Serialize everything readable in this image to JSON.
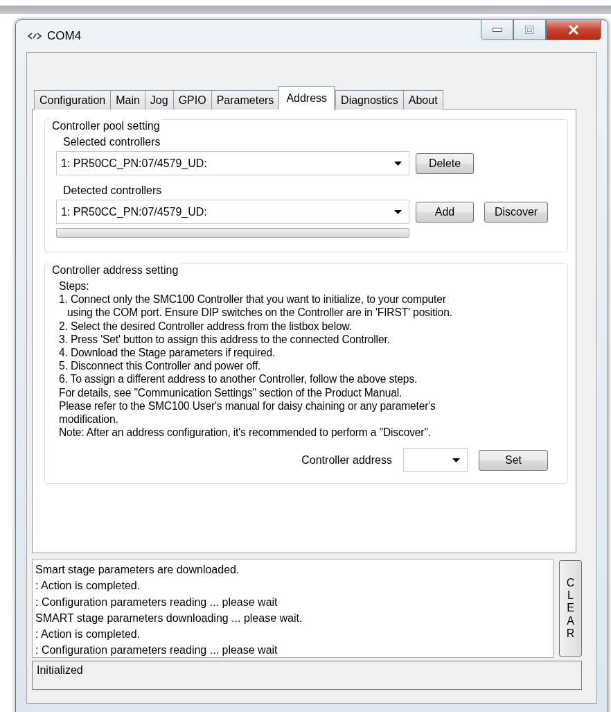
{
  "window": {
    "title": "COM4"
  },
  "tabs": [
    {
      "label": "Configuration",
      "selected": false
    },
    {
      "label": "Main",
      "selected": false
    },
    {
      "label": "Jog",
      "selected": false
    },
    {
      "label": "GPIO",
      "selected": false
    },
    {
      "label": "Parameters",
      "selected": false
    },
    {
      "label": "Address",
      "selected": true
    },
    {
      "label": "Diagnostics",
      "selected": false
    },
    {
      "label": "About",
      "selected": false
    }
  ],
  "pool_group": {
    "title": "Controller pool setting",
    "selected_label": "Selected controllers",
    "selected_value": "1: PR50CC_PN:07/4579_UD:",
    "delete_button": "Delete",
    "detected_label": "Detected controllers",
    "detected_value": "1: PR50CC_PN:07/4579_UD:",
    "add_button": "Add",
    "discover_button": "Discover",
    "progress": {
      "level": 0
    }
  },
  "address_group": {
    "title": "Controller address setting",
    "instructions": [
      {
        "text": "Steps:",
        "indent": false
      },
      {
        "text": "1. Connect only the SMC100 Controller that you want to initialize, to your computer",
        "indent": false
      },
      {
        "text": "using the COM port.  Ensure DIP switches on the Controller are in 'FIRST' position.",
        "indent": true
      },
      {
        "text": "2. Select the desired Controller address from the listbox below.",
        "indent": false
      },
      {
        "text": "3. Press 'Set' button to assign this address to the connected Controller.",
        "indent": false
      },
      {
        "text": "4. Download the Stage parameters if required.",
        "indent": false
      },
      {
        "text": "5. Disconnect this Controller and power off.",
        "indent": false
      },
      {
        "text": "6. To assign a different address to another Controller, follow the above steps.",
        "indent": false
      },
      {
        "text": "For details, see \"Communication Settings\" section of the Product Manual.",
        "indent": false
      },
      {
        "text": "Please refer to the SMC100 User's manual for daisy chaining or any parameter's",
        "indent": false
      },
      {
        "text": "modification.",
        "indent": false
      },
      {
        "text": "Note: After an address configuration, it's recommended to perform a \"Discover\".",
        "indent": false
      }
    ],
    "address_label": "Controller address",
    "set_button": "Set"
  },
  "log": [
    "Smart stage parameters are downloaded.",
    ": Action is completed.",
    ": Configuration parameters reading ... please wait",
    "SMART stage parameters downloading ... please wait.",
    ": Action is completed.",
    ": Configuration parameters reading ... please wait"
  ],
  "clear_button": "CLEAR",
  "status_bar": "Initialized"
}
